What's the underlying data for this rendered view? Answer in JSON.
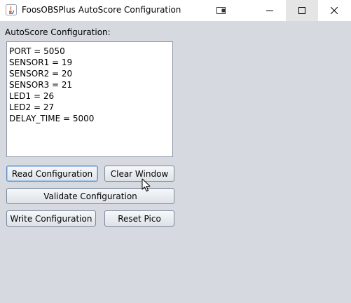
{
  "window": {
    "title": "FoosOBSPlus AutoScore Configuration",
    "controls": [
      "restore-extra-icon",
      "minimize-icon",
      "maximize-icon",
      "close-icon"
    ]
  },
  "main": {
    "section_label": "AutoScore Configuration:",
    "config_lines": [
      "PORT = 5050",
      "SENSOR1 = 19",
      "SENSOR2 = 20",
      "SENSOR3 = 21",
      "LED1 = 26",
      "LED2 = 27",
      "DELAY_TIME = 5000"
    ],
    "buttons": {
      "read": "Read Configuration",
      "clear": "Clear Window",
      "validate": "Validate Configuration",
      "write": "Write Configuration",
      "reset": "Reset Pico"
    }
  },
  "colors": {
    "window_background": "#d6d9df",
    "titlebar": "#ffffff",
    "focus_border": "#5f8fc7"
  }
}
